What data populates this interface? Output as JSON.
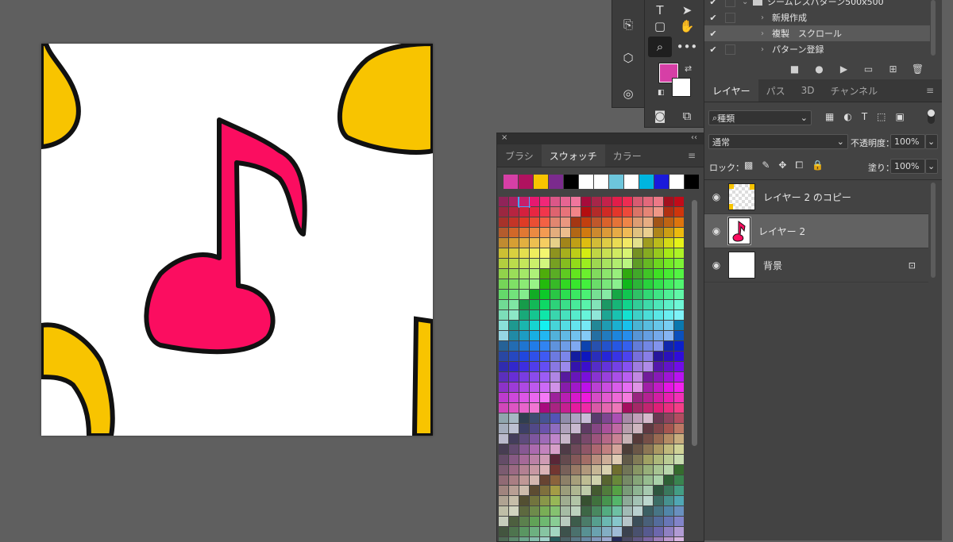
{
  "actions": {
    "set_name": "シームレスパターン500x500",
    "items": [
      {
        "label": "新規作成",
        "checked": true,
        "highlight": false
      },
      {
        "label": "複製　スクロール",
        "checked": true,
        "highlight": true
      },
      {
        "label": "パターン登録",
        "checked": true,
        "highlight": false
      }
    ],
    "check_glyph": "✔"
  },
  "tools": {
    "foreground": "#d63fa6",
    "background": "#ffffff"
  },
  "layers_panel": {
    "tabs": [
      "レイヤー",
      "パス",
      "3D",
      "チャンネル"
    ],
    "active_tab": 0,
    "filter_label": "種類",
    "blend_mode": "通常",
    "opacity_label": "不透明度：",
    "opacity_value": "100%",
    "lock_label": "ロック：",
    "fill_label": "塗り：",
    "fill_value": "100%",
    "layers": [
      {
        "name": "レイヤー 2 のコピー",
        "selected": false,
        "thumb": "copy"
      },
      {
        "name": "レイヤー 2",
        "selected": true,
        "thumb": "note"
      },
      {
        "name": "背景",
        "selected": false,
        "thumb": "bg"
      }
    ]
  },
  "swatches_panel": {
    "tabs": [
      "ブラシ",
      "スウォッチ",
      "カラー"
    ],
    "active_tab": 1,
    "close_glyph": "×",
    "collapse_glyph": "‹‹",
    "recent": [
      "#d63fa6",
      "#b0125f",
      "#f8c400",
      "#7b2b8d",
      "#000000",
      "#ffffff",
      "#ffffff",
      "#6dc6dc",
      "#ffffff",
      "#00b5e0",
      "#1a1adb",
      "#ffffff",
      "#000000"
    ]
  },
  "canvas": {
    "note_fill": "#fb0d60",
    "blob_fill": "#f8c400",
    "outline": "#111111"
  }
}
